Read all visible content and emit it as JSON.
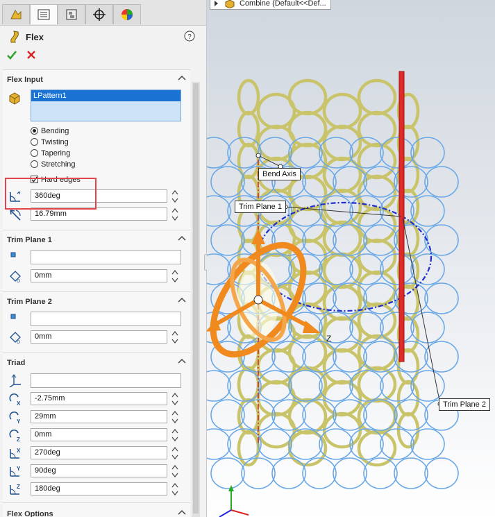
{
  "tabs": [
    {
      "name": "feature-manager-tab",
      "icon": "feature-manager-icon"
    },
    {
      "name": "property-manager-tab",
      "icon": "property-manager-icon"
    },
    {
      "name": "configuration-manager-tab",
      "icon": "configuration-manager-icon"
    },
    {
      "name": "dimxpert-tab",
      "icon": "crosshair-icon"
    },
    {
      "name": "display-manager-tab",
      "icon": "appearance-icon"
    }
  ],
  "header": {
    "title": "Flex",
    "help_icon": "help-icon",
    "ok_icon": "check-icon",
    "cancel_icon": "close-icon"
  },
  "flex_input": {
    "heading": "Flex Input",
    "bodies_selected": "LPattern1",
    "modes": [
      {
        "label": "Bending",
        "selected": true
      },
      {
        "label": "Twisting",
        "selected": false
      },
      {
        "label": "Tapering",
        "selected": false
      },
      {
        "label": "Stretching",
        "selected": false
      }
    ],
    "hard_edges_label": "Hard edges",
    "hard_edges_checked": true,
    "angle_value": "360deg",
    "radius_value": "16.79mm"
  },
  "trim_plane_1": {
    "heading": "Trim Plane 1",
    "reference": "",
    "distance": "0mm"
  },
  "trim_plane_2": {
    "heading": "Trim Plane 2",
    "reference": "",
    "distance": "0mm"
  },
  "triad": {
    "heading": "Triad",
    "reference": "",
    "x": "-2.75mm",
    "y": "29mm",
    "z": "0mm",
    "rot_x": "270deg",
    "rot_y": "90deg",
    "rot_z": "180deg"
  },
  "flex_options": {
    "heading": "Flex Options"
  },
  "viewport": {
    "tree_label": "Combine  (Default<<Def...",
    "callouts": {
      "bend_axis": "Bend Axis",
      "trim_plane_1": "Trim Plane 1",
      "trim_plane_2": "Trim Plane 2"
    },
    "triad_axis_z": "Z",
    "colors": {
      "rings": "#c9c46a",
      "preview": "#6aa7e6",
      "triad": "#f08a1e",
      "trim_plane": "#e02a2a",
      "bend_circle": "#1f2ccf"
    }
  }
}
